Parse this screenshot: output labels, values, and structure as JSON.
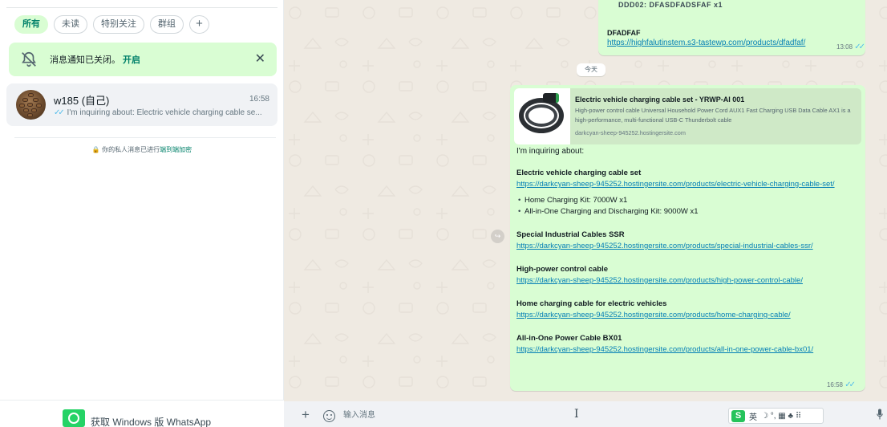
{
  "sidebar": {
    "filters": [
      {
        "label": "所有"
      },
      {
        "label": "未读"
      },
      {
        "label": "特别关注"
      },
      {
        "label": "群组"
      },
      {
        "label": "+"
      }
    ],
    "notice": {
      "text": "消息通知已关闭。",
      "link": "开启",
      "close": "✕"
    },
    "chat": {
      "name": "w185 (自己)",
      "time": "16:58",
      "ticks": "✓✓",
      "preview": "I'm inquiring about: Electric vehicle charging cable se..."
    },
    "privacy": {
      "lock": "🔒",
      "text": "你的私人消息已进行",
      "link": "端到端加密"
    },
    "get_app": "获取 Windows 版 WhatsApp"
  },
  "chat": {
    "prev_message": {
      "garbled": "DDD02: DFASDFADSFAF x1",
      "title": "DFADFAF",
      "link": "https://highfalutinstem.s3-tastewp.com/products/dfadfaf/",
      "time": "13:08",
      "ticks": "✓✓"
    },
    "date_divider": "今天",
    "forward_icon": "↪",
    "main_message": {
      "card": {
        "title": "Electric vehicle charging cable set - YRWP-AI 001",
        "description": "High-power control cable Universal Household Power Cord AUX1 Fast Charging USB Data Cable AX1 is a high-performance, multi-functional USB-C Thunderbolt cable",
        "domain": "darkcyan-sheep-945252.hostingersite.com"
      },
      "intro": "I'm inquiring about:",
      "products": [
        {
          "title": "Electric vehicle charging cable set",
          "link": "https://darkcyan-sheep-945252.hostingersite.com/products/electric-vehicle-charging-cable-set/",
          "items": [
            "Home Charging Kit: 7000W x1",
            "All-in-One Charging and Discharging Kit: 9000W x1"
          ]
        },
        {
          "title": "Special Industrial Cables SSR",
          "link": "https://darkcyan-sheep-945252.hostingersite.com/products/special-industrial-cables-ssr/"
        },
        {
          "title": "High-power control cable",
          "link": "https://darkcyan-sheep-945252.hostingersite.com/products/high-power-control-cable/"
        },
        {
          "title": "Home charging cable for electric vehicles",
          "link": "https://darkcyan-sheep-945252.hostingersite.com/products/home-charging-cable/"
        },
        {
          "title": "All-in-One Power Cable BX01",
          "link": "https://darkcyan-sheep-945252.hostingersite.com/products/all-in-one-power-cable-bx01/"
        }
      ],
      "time": "16:58",
      "ticks": "✓✓"
    }
  },
  "composer": {
    "plus": "+",
    "placeholder": "输入消息",
    "caret": "I",
    "ime": {
      "logo": "S",
      "lang": "英",
      "rest": "☽ °, ▦ ♣ ⠿"
    }
  },
  "colors": {
    "accent": "#008069",
    "bubble": "#d9fdd3",
    "link": "#027eb5",
    "tick": "#53bdeb",
    "wallpaper": "#efeae2"
  }
}
